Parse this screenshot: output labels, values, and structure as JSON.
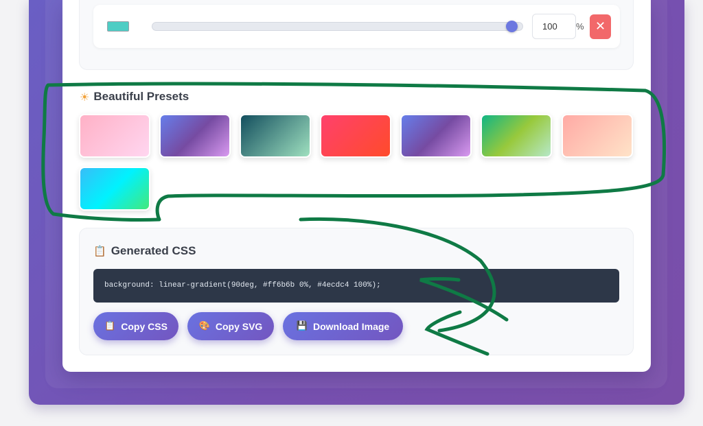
{
  "stop": {
    "color": "#4ecdc4",
    "position": "100",
    "unit": "%",
    "remove_icon": "close-icon",
    "remove_glyph": "✕"
  },
  "presets": {
    "title": "Beautiful Presets",
    "icon": "sun-icon",
    "icon_glyph": "☀",
    "items": [
      {
        "from": "#ffb1c6",
        "to": "#ffd6f0"
      },
      {
        "from": "#667eea",
        "mid": "#764ba2",
        "to": "#d99af0"
      },
      {
        "from": "#134e5e",
        "to": "#9fe0bf"
      },
      {
        "from": "#ff416c",
        "to": "#ff4b2b"
      },
      {
        "from": "#667eea",
        "mid": "#764ba2",
        "to": "#d99af0"
      },
      {
        "from": "#11b584",
        "mid": "#98c93c",
        "to": "#b6e8c8"
      },
      {
        "from": "#ffaaa5",
        "to": "#ffe3c8"
      },
      {
        "from": "#38bdf8",
        "mid": "#00f2fe",
        "to": "#43e97b"
      }
    ]
  },
  "generated": {
    "title": "Generated CSS",
    "icon": "clipboard-icon",
    "icon_glyph": "📋",
    "code": "background: linear-gradient(90deg, #ff6b6b 0%, #4ecdc4 100%);"
  },
  "buttons": {
    "copy_css": {
      "label": "Copy CSS",
      "icon": "clipboard-icon",
      "glyph": "📋"
    },
    "copy_svg": {
      "label": "Copy SVG",
      "icon": "palette-icon",
      "glyph": "🎨"
    },
    "download": {
      "label": "Download Image",
      "icon": "floppy-disk-icon",
      "glyph": "💾"
    }
  },
  "colors": {
    "accent": "#6a72e0",
    "annotation": "#0f7a45"
  }
}
